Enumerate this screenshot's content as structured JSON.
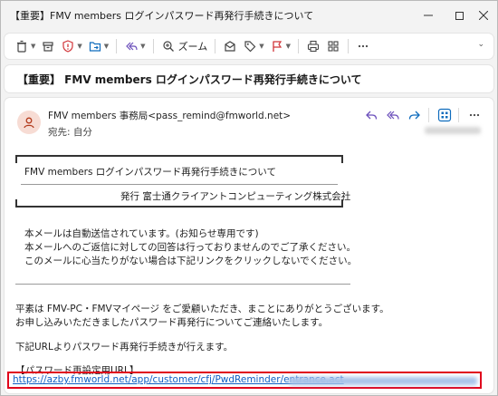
{
  "window": {
    "title": "【重要】FMV members ログインパスワード再発行手続きについて",
    "controls": {
      "minimize": "–",
      "maximize": "□",
      "close": "✕"
    }
  },
  "toolbar": {
    "items": [
      {
        "icon": "trash-icon",
        "has_caret": true
      },
      {
        "icon": "archive-icon",
        "has_caret": false
      },
      {
        "icon": "report-icon",
        "has_caret": true
      },
      {
        "icon": "move-folder-icon",
        "has_caret": true
      },
      {
        "icon": "reply-all-icon",
        "has_caret": true
      },
      {
        "icon": "zoom-icon",
        "label": "ズーム"
      },
      {
        "icon": "envelope-icon"
      },
      {
        "icon": "tag-icon",
        "has_caret": true
      },
      {
        "icon": "flag-icon",
        "has_caret": true
      },
      {
        "icon": "print-icon"
      },
      {
        "icon": "apps-icon"
      },
      {
        "icon": "more-icon"
      }
    ],
    "zoom_label": "ズーム"
  },
  "subject": "【重要】 FMV members ログインパスワード再発行手続きについて",
  "message": {
    "sender": "FMV members 事務局<pass_remind@fmworld.net>",
    "recipient": "宛先:  自分",
    "box_title": "FMV members ログインパスワード再発行手続きについて",
    "box_issuer": "発行 富士通クライアントコンピューティング株式会社",
    "notice_lines": [
      "本メールは自動送信されています。(お知らせ専用です)",
      "本メールへのご返信に対しての回答は行っておりませんのでご了承ください。",
      "このメールに心当たりがない場合は下記リンクをクリックしないでください。"
    ],
    "greeting_lines": [
      "平素は FMV-PC・FMVマイページ をご愛顧いただき、まことにありがとうございます。",
      "お申し込みいただきましたパスワード再発行についてご連絡いたします。"
    ],
    "instruction": "下記URLよりパスワード再発行手続きが行えます。",
    "url_label": "【パスワード再設定用URL】",
    "url": "https://azby.fmworld.net/app/customer/cfj/PwdReminder/entrance.act"
  },
  "colors": {
    "accent": "#0f6cbd",
    "highlight_border": "#e0001b",
    "link": "#0f5fc4",
    "avatar_bg": "#f7dcd4",
    "avatar_fg": "#b23a1c"
  }
}
